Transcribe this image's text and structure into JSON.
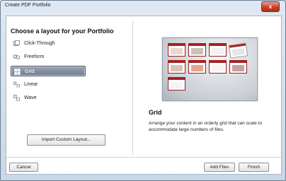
{
  "window": {
    "title": "Create PDF Portfolio",
    "close_glyph": "x"
  },
  "heading": "Choose a layout for your Portfolio",
  "layouts": [
    {
      "label": "Click-Through",
      "icon": "click-through-icon",
      "selected": false
    },
    {
      "label": "Freeform",
      "icon": "freeform-icon",
      "selected": false
    },
    {
      "label": "Grid",
      "icon": "grid-icon",
      "selected": true
    },
    {
      "label": "Linear",
      "icon": "linear-icon",
      "selected": false
    },
    {
      "label": "Wave",
      "icon": "wave-icon",
      "selected": false
    }
  ],
  "import_button": "Import Custom Layout...",
  "detail": {
    "title": "Grid",
    "description": "Arrange your content in an orderly grid that can scale to accommodate large numbers of files."
  },
  "buttons": {
    "cancel": "Cancel",
    "add_files": "Add Files",
    "finish": "Finish"
  },
  "colors": {
    "accent_red": "#a92222",
    "selection": "#7a8697",
    "close": "#c7402c"
  }
}
